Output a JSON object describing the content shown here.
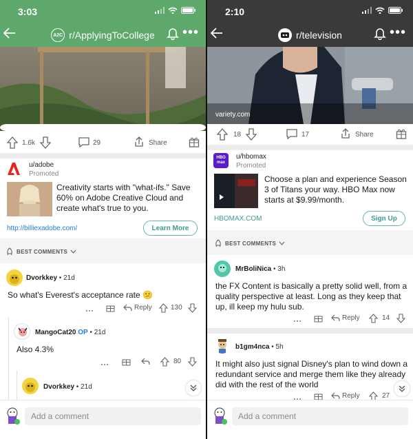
{
  "left": {
    "status": {
      "time": "3:03"
    },
    "header": {
      "subreddit": "r/ApplyingToCollege",
      "icon_text": "A2C",
      "color": "#5fa86c"
    },
    "post_actions": {
      "score": "1.6k",
      "comments": "29",
      "share": "Share"
    },
    "promo": {
      "user": "u/adobe",
      "tag": "Promoted",
      "text": "Creativity starts with \"what-ifs.\" Save 60% on Adobe Creative Cloud and create what's true to you.",
      "link": "http://billiexadobe.com/",
      "cta": "Learn More"
    },
    "sort": {
      "label": "BEST COMMENTS"
    },
    "comments": [
      {
        "author": "Dvorkkey",
        "age": "21d",
        "op": "",
        "body": "So what's Everest's acceptance rate 😕",
        "reply": "Reply",
        "score": "130"
      },
      {
        "author": "MangoCat20",
        "age": "21d",
        "op": "OP",
        "body": "Also 4.3%",
        "reply": "",
        "score": "80"
      },
      {
        "author": "Dvorkkey",
        "age": "21d",
        "op": ""
      }
    ],
    "add_comment": {
      "placeholder": "Add a comment"
    }
  },
  "right": {
    "status": {
      "time": "2:10"
    },
    "header": {
      "subreddit": "r/television",
      "color": "#3a3a3a"
    },
    "hero": {
      "source": "variety.com"
    },
    "post_actions": {
      "score": "18",
      "comments": "17",
      "share": "Share"
    },
    "promo": {
      "user": "u/hbomax",
      "tag": "Promoted",
      "logo_text": "HBO max",
      "text": "Choose a plan and experience Season 3 of Titans your way. HBO Max now starts at $9.99/month.",
      "link": "HBOMAX.COM",
      "cta": "Sign Up"
    },
    "sort": {
      "label": "BEST COMMENTS"
    },
    "comments": [
      {
        "author": "MrBoliNica",
        "age": "3h",
        "body": "the FX Content is basically a pretty solid well, from a quality perspective at least. Long as they keep that up, ill keep my hulu sub.",
        "reply": "Reply",
        "score": "14"
      },
      {
        "author": "b1gm4nca",
        "age": "5h",
        "body": "It might also just signal Disney's plan to wind down a redundant service and merge them like they already did with the rest of the world",
        "reply": "Reply",
        "score": "27"
      }
    ],
    "add_comment": {
      "placeholder": "Add a comment"
    }
  },
  "colors": {
    "accent_teal": "#5fb5a8",
    "link_blue": "#1e7dd6",
    "op_blue": "#1e7dd6"
  }
}
